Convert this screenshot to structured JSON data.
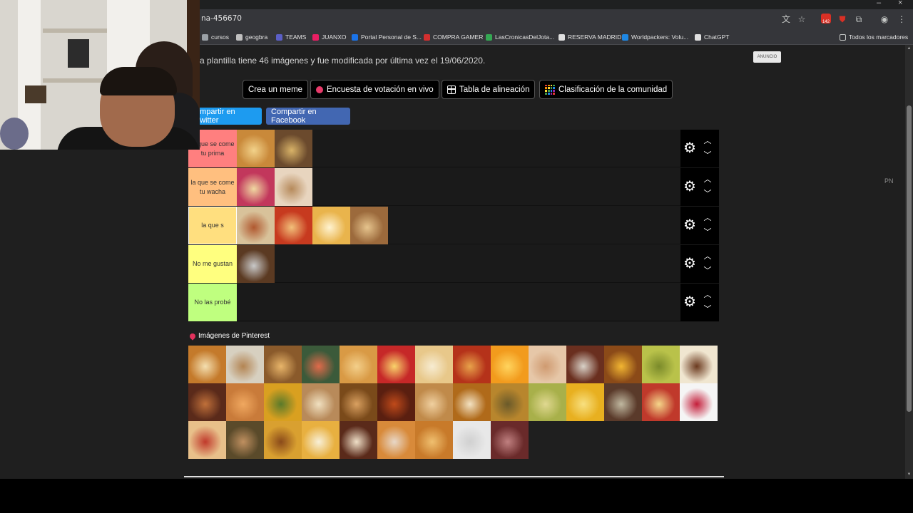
{
  "browser": {
    "url_text": "na-456670",
    "ext_badge": "142",
    "bookmarks": [
      {
        "label": "cursos",
        "icon": "puzzle-icon",
        "color": "#9aa0a6"
      },
      {
        "label": "geogbra",
        "icon": "geogebra-icon",
        "color": "#c0c0c0"
      },
      {
        "label": "TEAMS",
        "icon": "teams-icon",
        "color": "#5b5fc7"
      },
      {
        "label": "JUANXO",
        "icon": "juanxo-icon",
        "color": "#e91e63"
      },
      {
        "label": "Portal Personal de S...",
        "icon": "globe-icon",
        "color": "#1a73e8"
      },
      {
        "label": "COMPRA GAMER",
        "icon": "compragamer-icon",
        "color": "#d32f2f"
      },
      {
        "label": "LasCronicasDelJota...",
        "icon": "k-icon",
        "color": "#34a853"
      },
      {
        "label": "RESERVA MADRID",
        "icon": "flag-icon",
        "color": "#e0e0e0"
      },
      {
        "label": "Worldpackers: Volu...",
        "icon": "worldpackers-icon",
        "color": "#1e88e5"
      },
      {
        "label": "ChatGPT",
        "icon": "chatgpt-icon",
        "color": "#e0e0e0"
      }
    ],
    "all_bookmarks": "Todos los marcadores"
  },
  "page": {
    "description": "a plantilla tiene 46 imágenes y fue modificada por última vez el 19/06/2020.",
    "ad_label": "ANUNCIO",
    "side_label": "PN",
    "actions": {
      "meme": "Crea un meme",
      "poll": "Encuesta de votación en vivo",
      "alignment": "Tabla de alineación",
      "community": "Clasificación de la comunidad"
    },
    "share": {
      "twitter": "ompartir en Twitter",
      "facebook": "Compartir en Facebook"
    },
    "tiers": [
      {
        "label": "la que se come tu prima",
        "color": "#ff7f7f",
        "items": [
          [
            "#c9893a",
            "#f2d28a"
          ],
          [
            "#6b4a2d",
            "#d9b368"
          ]
        ]
      },
      {
        "label": "la que se come tu wacha",
        "color": "#ffbf7f",
        "items": [
          [
            "#c2375c",
            "#f0d9a1"
          ],
          [
            "#e8d5bf",
            "#b68a5b"
          ]
        ]
      },
      {
        "label": "la que s",
        "color": "#ffdf7f",
        "editing": true,
        "items": [
          [
            "#d8c29a",
            "#b0582f"
          ],
          [
            "#c73a1f",
            "#f2c07a"
          ],
          [
            "#e9b44c",
            "#fff3d0"
          ],
          [
            "#9c6a3c",
            "#e6c48d"
          ]
        ]
      },
      {
        "label": "No me gustan",
        "color": "#ffff7f",
        "items": [
          [
            "#5b3a22",
            "#c9c9c9"
          ]
        ]
      },
      {
        "label": "No las probé",
        "color": "#bfff7f",
        "items": []
      }
    ],
    "pinterest_heading": "Imágenes de Pinterest",
    "pool": [
      [
        "#c47a2b",
        "#f4dfb0"
      ],
      [
        "#d7d0c0",
        "#b38452"
      ],
      [
        "#8a5a2b",
        "#e8b56a"
      ],
      [
        "#3b5a3a",
        "#e06a4a"
      ],
      [
        "#d99a45",
        "#f3cf8a"
      ],
      [
        "#c62828",
        "#f9d36b"
      ],
      [
        "#e8c88a",
        "#f7ecd2"
      ],
      [
        "#b5321a",
        "#e8a24a"
      ],
      [
        "#f29b1d",
        "#ffd45e"
      ],
      [
        "#e6c7a8",
        "#cf9a70"
      ],
      [
        "#6a2f1f",
        "#d9d2c8"
      ],
      [
        "#8b4a18",
        "#f2b632"
      ],
      [
        "#b9c24a",
        "#7a8a2a"
      ],
      [
        "#f0e6d0",
        "#6b3a1f"
      ],
      [
        "#5a2a1a",
        "#c0703a"
      ],
      [
        "#c97b3a",
        "#f0a860"
      ],
      [
        "#d9a020",
        "#5a7a2a"
      ],
      [
        "#b88a5a",
        "#f0e0c0"
      ],
      [
        "#7a4a1a",
        "#d9a060"
      ],
      [
        "#5a1f10",
        "#c04a1a"
      ],
      [
        "#c08a4a",
        "#f0d0a0"
      ],
      [
        "#b06a1a",
        "#f3e2c2"
      ],
      [
        "#b8862d",
        "#6a5a2a"
      ],
      [
        "#a8b04a",
        "#e0d890"
      ],
      [
        "#e8b020",
        "#f8e080"
      ],
      [
        "#5a3a2a",
        "#c0b8a0"
      ],
      [
        "#c0392b",
        "#f5d68a"
      ],
      [
        "#f5f5f5",
        "#c41e3a"
      ],
      [
        "#e8c08a",
        "#c0392b"
      ],
      [
        "#5a4a2a",
        "#c09060"
      ],
      [
        "#d9a030",
        "#8a4a1a"
      ],
      [
        "#e8b040",
        "#f8f0d8"
      ],
      [
        "#5a2a1a",
        "#f0e0c8"
      ],
      [
        "#d88a3a",
        "#e8d8c8"
      ],
      [
        "#c87a2a",
        "#f0c070"
      ],
      [
        "#e8e8e8",
        "#d0d0d0"
      ],
      [
        "#6a2a2a",
        "#c08080"
      ]
    ]
  }
}
